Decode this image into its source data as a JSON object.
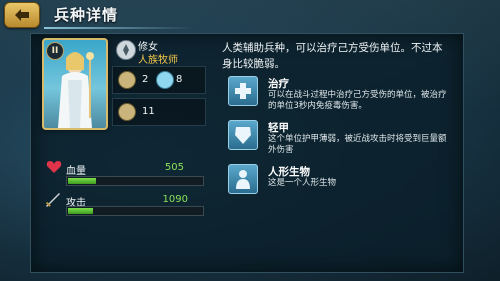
{
  "header": {
    "title": "兵种详情",
    "back_icon": "back-arrow-icon"
  },
  "unit": {
    "name": "修女",
    "class": "人族牧师",
    "card_level": "II",
    "stats": {
      "stat_a": "2",
      "stat_b": "8",
      "stat_c": "11"
    }
  },
  "bars": {
    "hp": {
      "label": "血量",
      "value": "505",
      "fill": 0.21
    },
    "attack": {
      "label": "攻击",
      "value": "1090",
      "fill": 0.19
    }
  },
  "description": "人类辅助兵种，可以治疗己方受伤单位。不过本身比较脆弱。",
  "traits": [
    {
      "name": "治疗",
      "desc": "可以在战斗过程中治疗己方受伤的单位，被治疗的单位3秒内免疫毒伤害。",
      "icon": "heal-icon"
    },
    {
      "name": "轻甲",
      "desc": "这个单位护甲薄弱，被近战攻击时将受到巨量额外伤害",
      "icon": "light-armor-icon"
    },
    {
      "name": "人形生物",
      "desc": "这是一个人形生物",
      "icon": "humanoid-icon"
    }
  ],
  "colors": {
    "accent_gold": "#d8bb6a",
    "bar_green": "#7ee04c",
    "class_yellow": "#f3c64b"
  }
}
